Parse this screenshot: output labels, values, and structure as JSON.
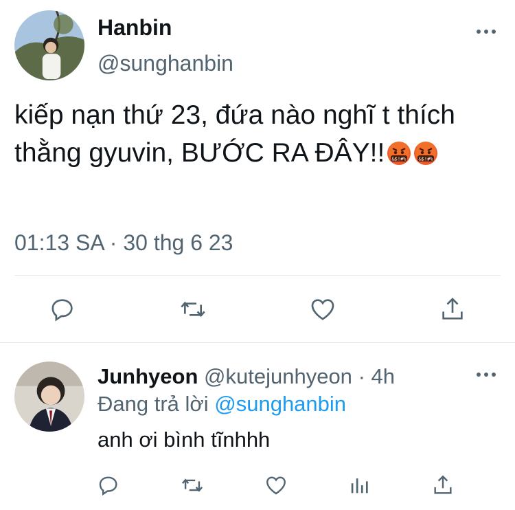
{
  "tweet": {
    "author_name": "Hanbin",
    "author_handle": "@sunghanbin",
    "text": "kiếp nạn thứ 23, đứa nào nghĩ t thích thằng gyuvin, BƯỚC RA ĐÂY!!",
    "emojis": [
      "face-with-symbols-on-mouth-emoji",
      "face-with-symbols-on-mouth-emoji"
    ],
    "timestamp": "01:13 SA · 30 thg 6 23",
    "actions": [
      "reply-icon",
      "retweet-icon",
      "like-icon",
      "share-icon"
    ]
  },
  "reply": {
    "author_name": "Junhyeon",
    "author_handle": "@kutejunhyeon",
    "time": "· 4h",
    "replying_prefix": "Đang trả lời",
    "replying_to": "@sunghanbin",
    "text": "anh ơi bình tĩnhhh",
    "actions": [
      "reply-icon",
      "retweet-icon",
      "like-icon",
      "analytics-icon",
      "share-icon"
    ]
  },
  "colors": {
    "text": "#0f1419",
    "secondary": "#536471",
    "accent": "#1d9bf0",
    "divider": "#e6e9ec"
  }
}
